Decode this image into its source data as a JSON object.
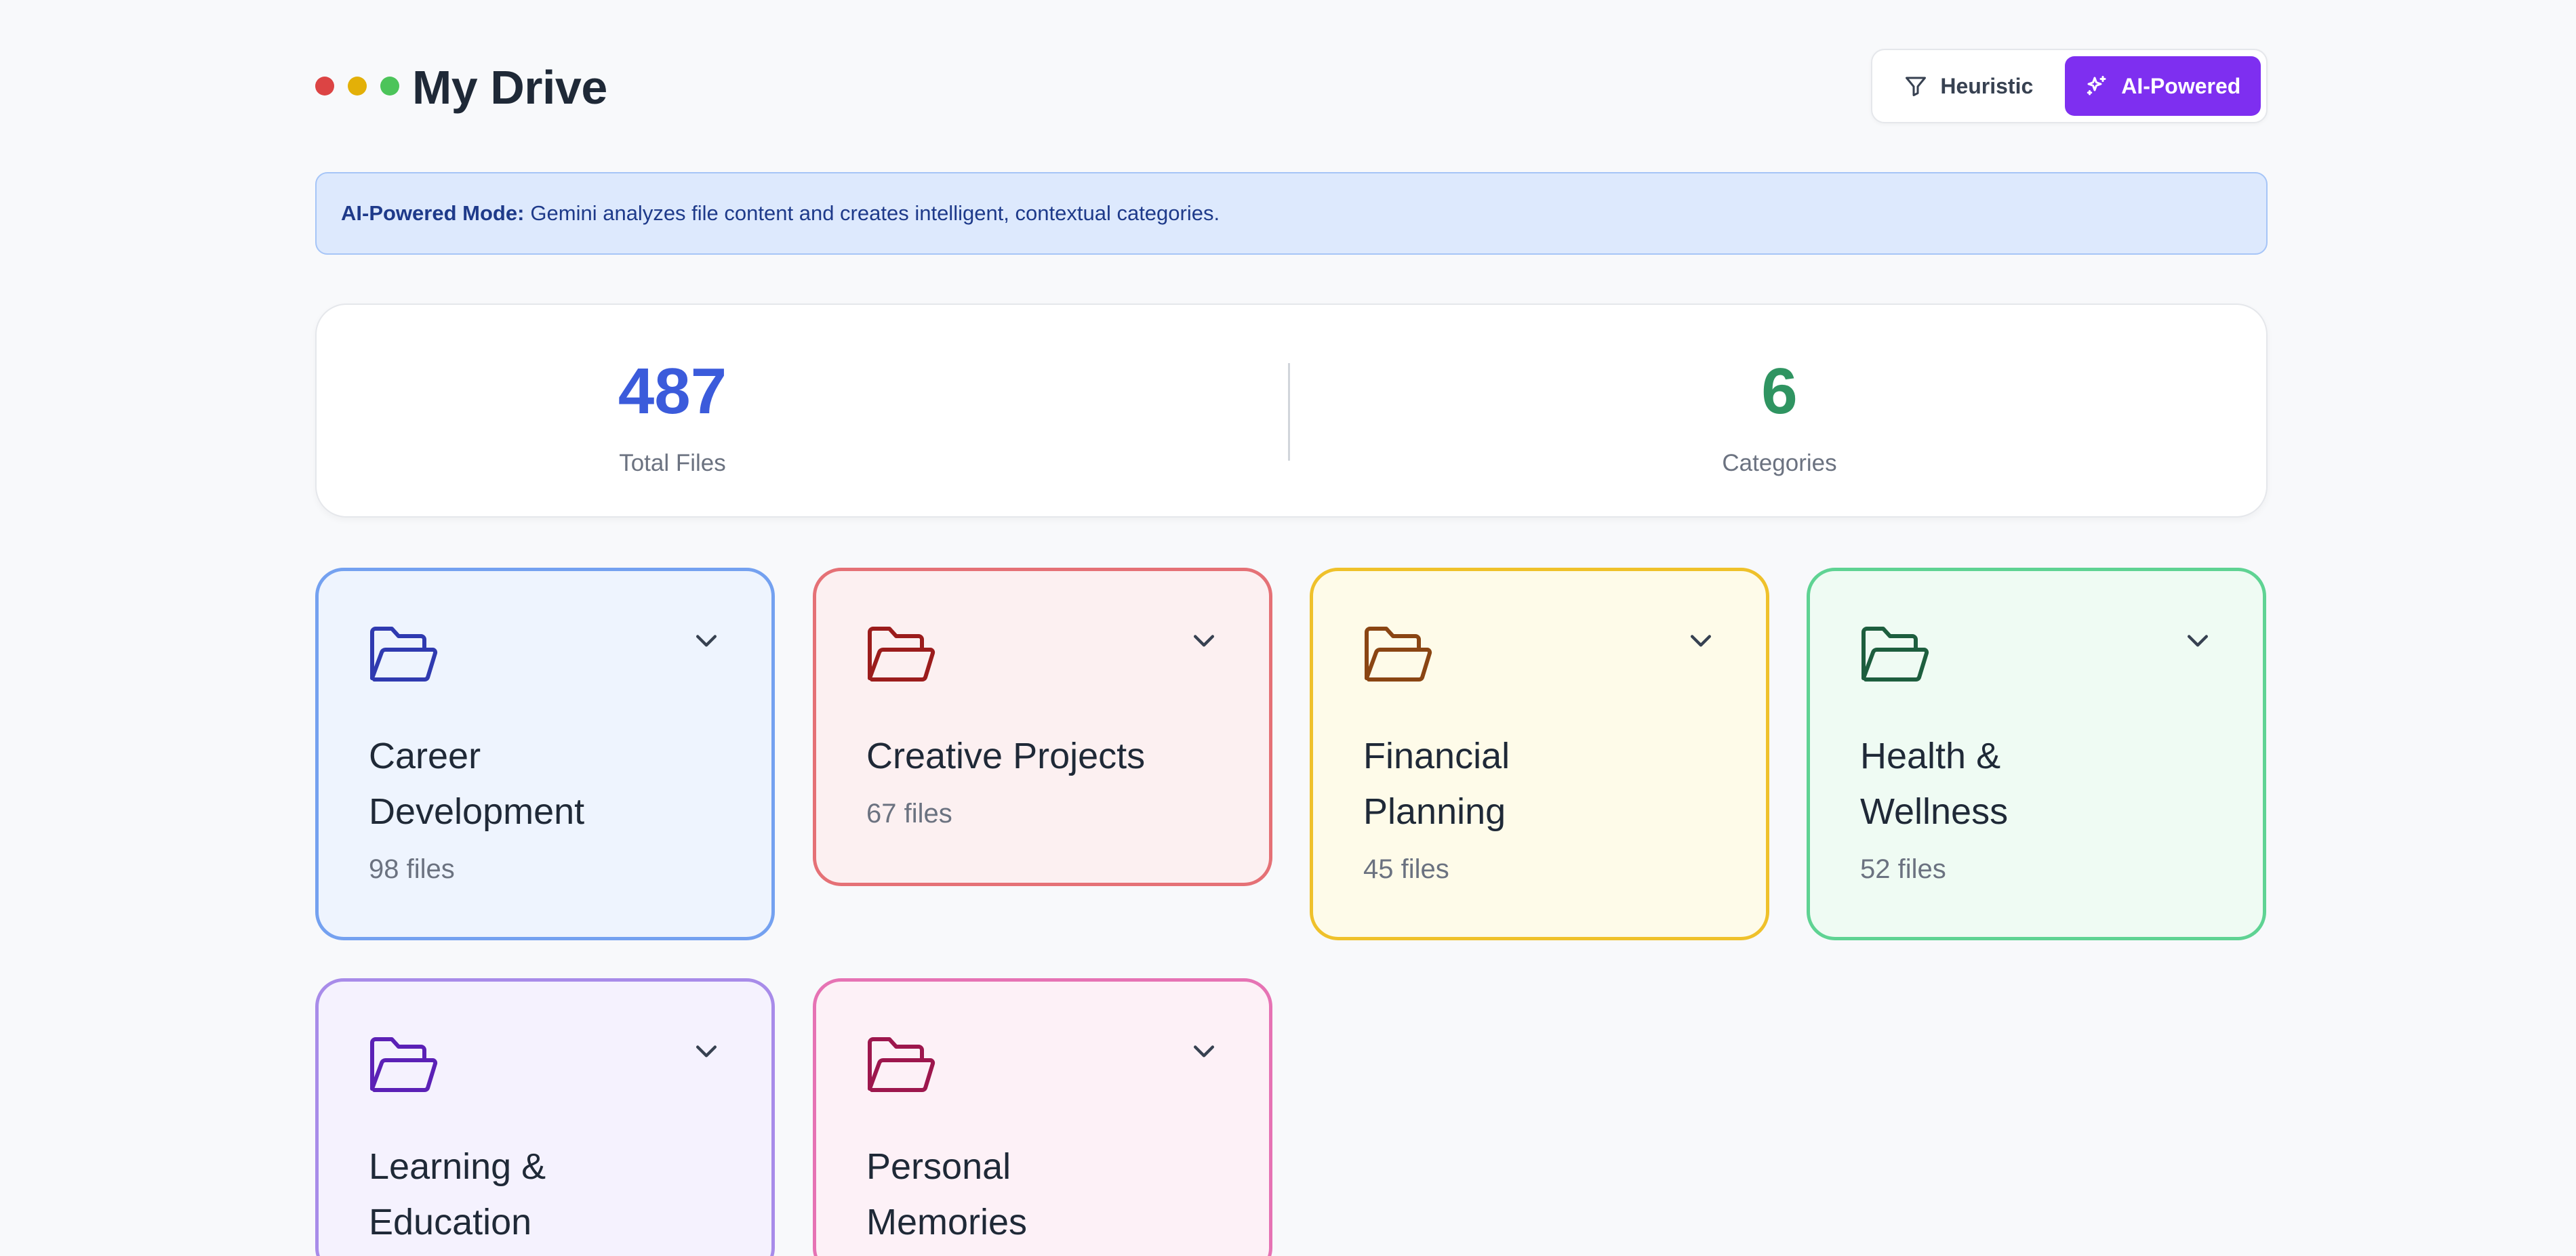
{
  "header": {
    "title": "My Drive",
    "modes": {
      "heuristic_label": "Heuristic",
      "ai_label": "AI-Powered",
      "active": "AI-Powered"
    }
  },
  "banner": {
    "strong": "AI-Powered Mode:",
    "text": "Gemini analyzes file content and creates intelligent, contextual categories."
  },
  "stats": {
    "total_files": {
      "value": "487",
      "label": "Total Files"
    },
    "categories": {
      "value": "6",
      "label": "Categories"
    }
  },
  "categories": [
    {
      "line1": "Career",
      "line2": "Development",
      "count": "98 files",
      "color": "#2f3ab0"
    },
    {
      "line1": "Creative Projects",
      "line2": "",
      "count": "67 files",
      "color": "#9b1c1c"
    },
    {
      "line1": "Financial",
      "line2": "Planning",
      "count": "45 files",
      "color": "#8a4513"
    },
    {
      "line1": "Health &",
      "line2": "Wellness",
      "count": "52 files",
      "color": "#1d5e3e"
    },
    {
      "line1": "Learning &",
      "line2": "Education",
      "count": "",
      "color": "#5b21b6"
    },
    {
      "line1": "Personal",
      "line2": "Memories",
      "count": "",
      "color": "#9d174d"
    }
  ],
  "colors": {
    "accent": "#7e2ff0",
    "total_files": "#3b5bdb",
    "categories_count": "#2f9461"
  },
  "icons": {
    "heuristic": "filter-icon",
    "ai": "sparkles-icon",
    "card": "folder-open-icon",
    "expand": "chevron-down-icon"
  }
}
